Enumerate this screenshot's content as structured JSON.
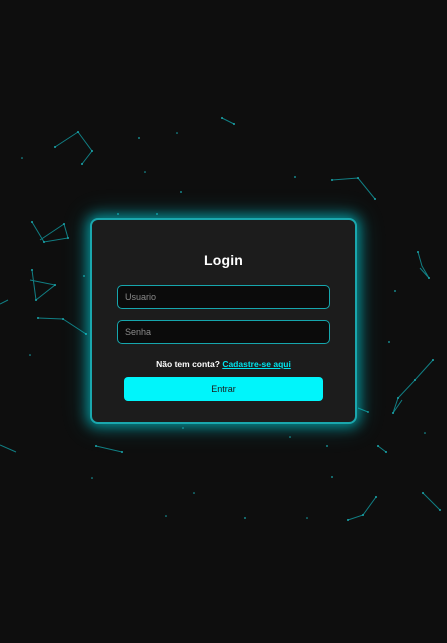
{
  "login": {
    "title": "Login",
    "username_placeholder": "Usuario",
    "password_placeholder": "Senha",
    "signup_prompt": "Não tem conta?",
    "signup_link": "Cadastre-se aqui",
    "submit_label": "Entrar"
  },
  "colors": {
    "background": "#0e0e0e",
    "card": "#1c1c1c",
    "accent": "#00f5fb",
    "constellation": "#117f84"
  }
}
